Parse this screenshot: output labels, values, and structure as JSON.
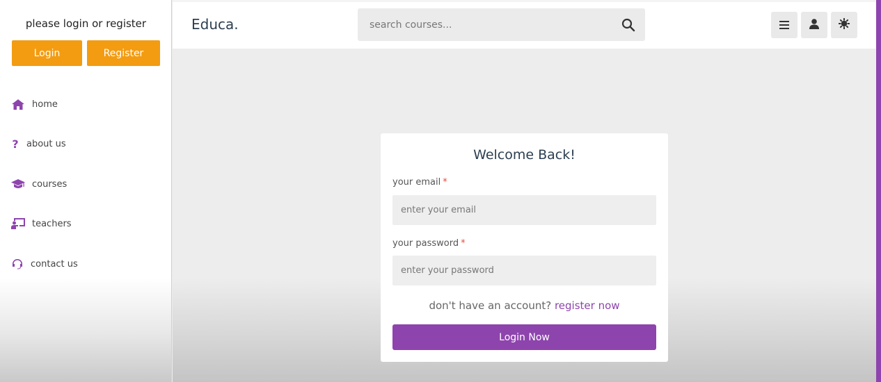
{
  "sidebar": {
    "prompt": "please login or register",
    "login_label": "Login",
    "register_label": "Register",
    "nav": [
      {
        "label": "home",
        "icon": "home-icon"
      },
      {
        "label": "about us",
        "icon": "question-icon"
      },
      {
        "label": "courses",
        "icon": "graduation-cap-icon"
      },
      {
        "label": "teachers",
        "icon": "chalkboard-teacher-icon"
      },
      {
        "label": "contact us",
        "icon": "headset-icon"
      }
    ]
  },
  "header": {
    "logo": "Educa.",
    "search_placeholder": "search courses...",
    "icons": [
      "menu-icon",
      "user-icon",
      "theme-toggle-icon"
    ]
  },
  "login": {
    "title": "Welcome Back!",
    "email_label": "your email",
    "email_placeholder": "enter your email",
    "password_label": "your password",
    "password_placeholder": "enter your password",
    "required_mark": "*",
    "signup_prompt": "don't have an account?",
    "signup_link": "register now",
    "submit_label": "Login Now"
  },
  "colors": {
    "accent": "#8e44ad",
    "orange": "#f39c12",
    "required": "#e74c3c"
  }
}
